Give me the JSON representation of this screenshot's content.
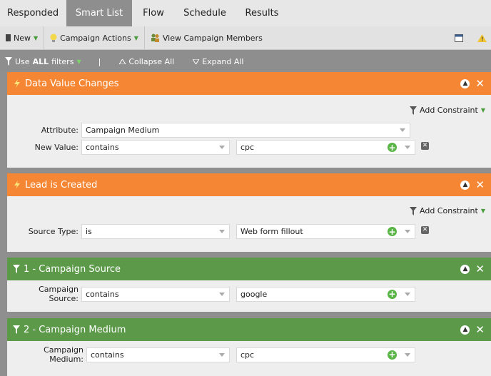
{
  "tabs": [
    "Responded",
    "Smart List",
    "Flow",
    "Schedule",
    "Results"
  ],
  "toolbar": {
    "new_label": "New",
    "campaign_actions_label": "Campaign Actions",
    "view_members_label": "View Campaign Members"
  },
  "filterbar": {
    "use_prefix": "Use",
    "use_bold": "ALL",
    "use_suffix": "filters",
    "separator": "|",
    "collapse_label": "Collapse All",
    "expand_label": "Expand All"
  },
  "filters": [
    {
      "title": "Data Value Changes",
      "add_constraint": "Add Constraint",
      "attribute_label": "Attribute:",
      "attribute_value": "Campaign Medium",
      "new_value_label": "New Value:",
      "operator": "contains",
      "value": "cpc"
    },
    {
      "title": "Lead is Created",
      "add_constraint": "Add Constraint",
      "source_type_label": "Source Type:",
      "operator": "is",
      "value": "Web form fillout"
    },
    {
      "title": "1 - Campaign Source",
      "label": "Campaign Source:",
      "operator": "contains",
      "value": "google"
    },
    {
      "title": "2 - Campaign Medium",
      "label": "Campaign Medium:",
      "operator": "contains",
      "value": "cpc"
    }
  ],
  "colors": {
    "orange_header": "#f58633",
    "green_header": "#5c9a4a",
    "active_tab": "#8e8e8e",
    "add_green": "#5ab547"
  }
}
